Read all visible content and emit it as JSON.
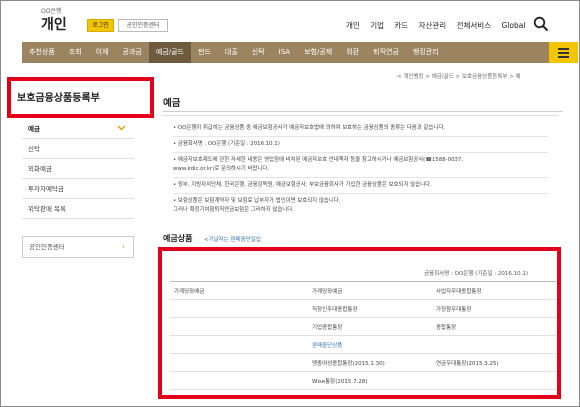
{
  "header": {
    "bank_sub": "OO은행",
    "bank_name": "개인",
    "login_label": "로그인",
    "cert_label": "공인인증센터",
    "top_links": [
      "개인",
      "기업",
      "카드",
      "자산관리",
      "전체서비스",
      "Global"
    ],
    "search_icon": "search-icon"
  },
  "nav": {
    "items": [
      "추천상품",
      "조회",
      "이체",
      "공과금",
      "예금/골드",
      "펀드",
      "대출",
      "신탁",
      "ISA",
      "보험/공제",
      "외환",
      "퇴직연금",
      "뱅킹관리"
    ],
    "active_index": 4,
    "menu_icon": "hamburger-icon",
    "bg_color": "#9c8461",
    "accent_color": "#f3c400"
  },
  "sidebar": {
    "title": "보호금융상품등록부",
    "items": [
      "예금",
      "신탁",
      "외화예금",
      "투자자예탁금",
      "위탁판매 목록"
    ],
    "active_index": 0,
    "cert_label": "공인인증센터"
  },
  "main": {
    "breadcrumb": "< 개인뱅킹 > 예금/골드 > 보호금융상품등록부 > 예",
    "title": "예금",
    "notice": [
      "• OO은행이 취급하는 금융상품 중 예금보험공사가 예금자보호법에 의하여 보호하는 금융상품의 종류는 다음과 같습니다.",
      "• 금융회사명 : OO은행 (기준일 : 2016.10.1)",
      "• 예금자보호제도에 관한 자세한 내용은 영업점에 비치된 예금자보호 안내책자 등을 참고하시거나 예금보험공사(☎1588-0037,",
      "  www.kdic.or.kr)로 문의하시기 바랍니다.",
      "• 정부, 지방자치단체, 한국은행, 금융감독원, 예금보험공사, 부보금융회사가 가입한 금융상품은 보호되지 않습니다.",
      "• 보험상품은 보험계약자 및 보험료 납부자가 법인이면 보호되지 않습니다.",
      "  그러나 확정기여형퇴직연금보험은 그러하지 않습니다."
    ],
    "section_title": "예금상품",
    "section_link": "<기날자는 판매중단일입",
    "company_line": "금융회사명 : OO은행 (기준일 : 2016.10.1)",
    "table": [
      [
        "가계당좌예금",
        "가계당좌예금",
        "사업자우대종합통장"
      ],
      [
        "",
        "직장인우대종합통장",
        "가정참우대통장"
      ],
      [
        "",
        "기업종합통장",
        "종합통장"
      ],
      [
        "",
        "판매중단상품",
        ""
      ],
      [
        "",
        "맹종여성종합통장(2015.1.30)",
        "연금우대통장(2015.3.25)"
      ],
      [
        "",
        "Wise통장(2015.7.28)",
        ""
      ]
    ]
  }
}
